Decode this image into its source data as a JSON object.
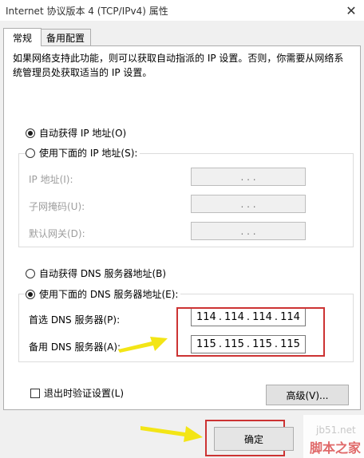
{
  "window": {
    "title": "Internet 协议版本 4 (TCP/IPv4) 属性",
    "close_glyph": "✕"
  },
  "tabs": [
    {
      "label": "常规",
      "active": true
    },
    {
      "label": "备用配置",
      "active": false
    }
  ],
  "description": "如果网络支持此功能，则可以获取自动指派的 IP 设置。否则，你需要从网络系统管理员处获取适当的 IP 设置。",
  "ip_section": {
    "auto_label": "自动获得 IP 地址(O)",
    "auto_checked": true,
    "manual_label": "使用下面的 IP 地址(S):",
    "manual_checked": false,
    "fields": [
      {
        "label": "IP 地址(I):",
        "value": ".   .   ."
      },
      {
        "label": "子网掩码(U):",
        "value": ".   .   ."
      },
      {
        "label": "默认网关(D):",
        "value": ".   .   ."
      }
    ]
  },
  "dns_section": {
    "auto_label": "自动获得 DNS 服务器地址(B)",
    "auto_checked": false,
    "manual_label": "使用下面的 DNS 服务器地址(E):",
    "manual_checked": true,
    "preferred": {
      "label": "首选 DNS 服务器(P):",
      "octets": [
        "114",
        ".",
        "114",
        ".",
        "114",
        ".",
        "114"
      ]
    },
    "alternate": {
      "label": "备用 DNS 服务器(A):",
      "octets": [
        "115",
        ".",
        "115",
        ".",
        "115",
        ".",
        "115"
      ]
    }
  },
  "validate_label": "退出时验证设置(L)",
  "validate_checked": false,
  "advanced_button": "高级(V)...",
  "ok_button": "确定",
  "watermark": {
    "site": "jb51.net",
    "name": "脚本之家"
  },
  "colors": {
    "highlight": "#cc3333",
    "arrow": "#f3e516"
  }
}
